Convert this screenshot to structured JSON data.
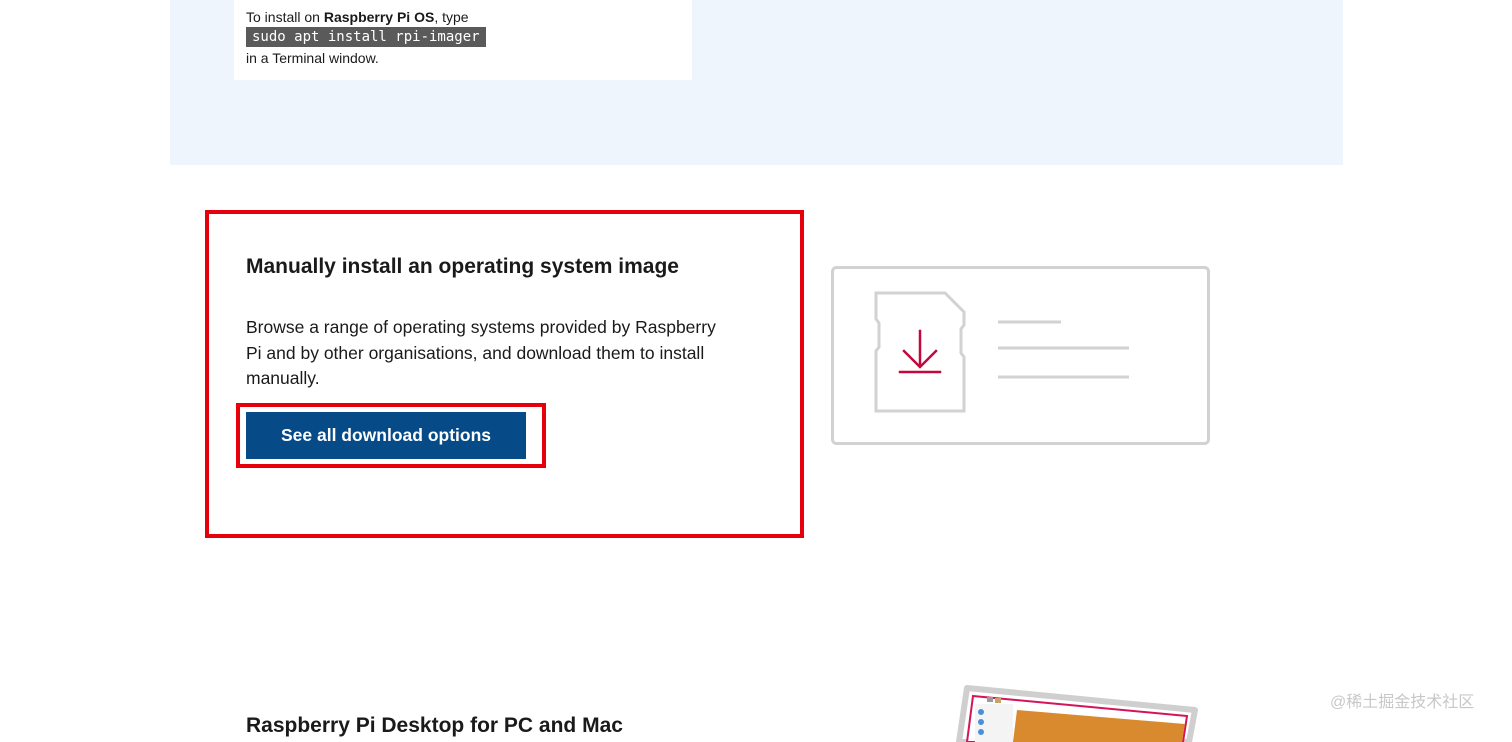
{
  "install": {
    "prefix": "To install on ",
    "os_name": "Raspberry Pi OS",
    "suffix": ", type",
    "command": "sudo apt install rpi-imager",
    "line3": "in a Terminal window."
  },
  "manual": {
    "title": "Manually install an operating system image",
    "description": "Browse a range of operating systems provided by Raspberry Pi and by other organisations, and download them to install manually.",
    "button_label": "See all download options"
  },
  "desktop": {
    "title": "Raspberry Pi Desktop for PC and Mac"
  },
  "watermark": "@稀土掘金技术社区",
  "colors": {
    "highlight": "#e5000b",
    "button": "#064b88",
    "section_bg": "#eef5fd",
    "download_icon": "#c3073f"
  }
}
